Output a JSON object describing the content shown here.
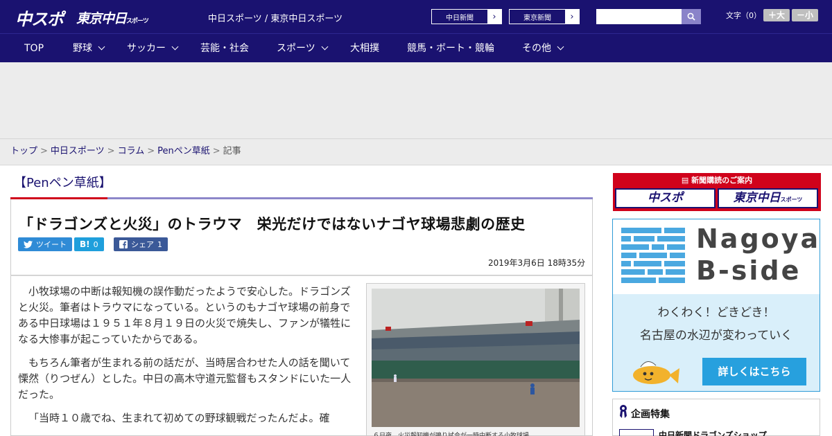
{
  "header": {
    "logo_chuspo": "中スポ",
    "logo_tokyo": "東京中日",
    "logo_tokyo_sub": "スポーツ",
    "site_names": "中日スポーツ / 東京中日スポーツ",
    "paper_buttons": [
      "中日新聞",
      "東京新聞"
    ],
    "fontsize_label": "文字（0）",
    "fontsize_up": "＋大",
    "fontsize_down": "－小",
    "search_placeholder": ""
  },
  "nav": {
    "items": [
      {
        "label": "TOP",
        "dropdown": false
      },
      {
        "label": "野球",
        "dropdown": true
      },
      {
        "label": "サッカー",
        "dropdown": true
      },
      {
        "label": "芸能・社会",
        "dropdown": false
      },
      {
        "label": "スポーツ",
        "dropdown": true
      },
      {
        "label": "大相撲",
        "dropdown": false
      },
      {
        "label": "競馬・ボート・競輪",
        "dropdown": false
      },
      {
        "label": "その他",
        "dropdown": true
      }
    ]
  },
  "breadcrumb": [
    "トップ",
    "中日スポーツ",
    "コラム",
    "Penペン草紙",
    "記事"
  ],
  "section_title": "【Penペン草紙】",
  "article": {
    "title": "「ドラゴンズと火災」のトラウマ　栄光だけではないナゴヤ球場悲劇の歴史",
    "share_tweet": "ツイート",
    "share_hatena": "B!",
    "share_hatena_count": "0",
    "share_fb": "シェア",
    "share_fb_count": "1",
    "date": "2019年3月6日 18時35分",
    "paragraphs": [
      "小牧球場の中断は報知機の誤作動だったようで安心した。ドラゴンズと火災。筆者はトラウマになっている。というのもナゴヤ球場の前身である中日球場は１９５１年８月１９日の火災で焼失し、ファンが犠牲になる大惨事が起こっていたからである。",
      "もちろん筆者が生まれる前の話だが、当時居合わせた人の話を聞いて慄然（りつぜん）とした。中日の高木守道元監督もスタンドにいた一人だった。",
      "「当時１０歳でね、生まれて初めての野球観戦だったんだよ。確"
    ],
    "photo_caption": "６日夜、火災報知機が鳴り試合が一時中断する小牧球場"
  },
  "sidebar": {
    "subscribe_head": "新聞購読のご案内",
    "subscribe_logos": [
      "中スポ",
      "東京中日"
    ],
    "subscribe_logo2_sub": "スポーツ",
    "bside_title_1": "Nagoya",
    "bside_title_2": "B-side",
    "bside_line_1": "わくわく！どきどき！",
    "bside_line_2": "名古屋の水辺が変わっていく",
    "bside_button": "詳しくはこちら",
    "feature_title": "企画特集",
    "feature_item": "中日新聞ドラゴンズショップ"
  },
  "colors": {
    "brand_navy": "#1a1270",
    "accent_red": "#d0021b",
    "bside_blue": "#27a0de"
  }
}
